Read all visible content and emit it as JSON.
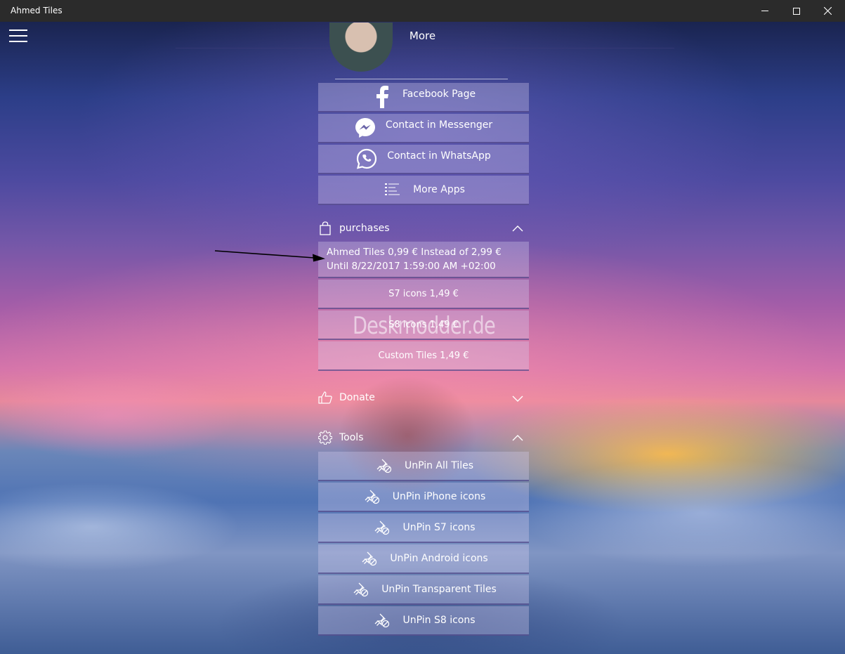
{
  "window": {
    "title": "Ahmed Tiles",
    "controls": [
      "minimize",
      "maximize",
      "close"
    ]
  },
  "header": {
    "title": "More",
    "menu_icon": "hamburger-icon"
  },
  "contact_buttons": [
    {
      "label": "Facebook Page",
      "icon": "facebook-icon"
    },
    {
      "label": "Contact in Messenger",
      "icon": "messenger-icon"
    },
    {
      "label": "Contact in WhatsApp",
      "icon": "whatsapp-icon"
    },
    {
      "label": "More Apps",
      "icon": "list-icon"
    }
  ],
  "purchases": {
    "title": "purchases",
    "icon": "bag-icon",
    "expanded": true,
    "items": [
      {
        "label": "Ahmed Tiles 0,99 € Instead of 2,99 € Until 8/22/2017 1:59:00 AM +02:00"
      },
      {
        "label": "S7 icons 1,49 €"
      },
      {
        "label": "S8 icons 1,49 €"
      },
      {
        "label": "Custom Tiles 1,49 €"
      }
    ]
  },
  "donate": {
    "title": "Donate",
    "icon": "thumbs-up-icon",
    "expanded": false
  },
  "tools": {
    "title": "Tools",
    "icon": "gear-icon",
    "expanded": true,
    "items": [
      {
        "label": "UnPin All Tiles",
        "icon": "unpin-icon"
      },
      {
        "label": "UnPin iPhone icons",
        "icon": "unpin-icon"
      },
      {
        "label": "UnPin S7 icons",
        "icon": "unpin-icon"
      },
      {
        "label": "UnPin Android icons",
        "icon": "unpin-icon"
      },
      {
        "label": "UnPin Transparent Tiles",
        "icon": "unpin-icon"
      },
      {
        "label": "UnPin S8 icons",
        "icon": "unpin-icon"
      }
    ]
  },
  "watermark": "Deskmodder.de"
}
